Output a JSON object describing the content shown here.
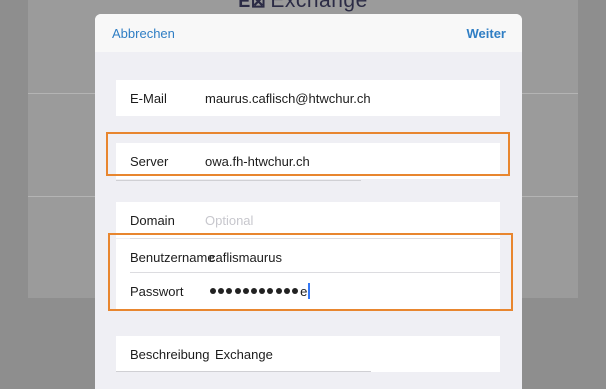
{
  "background": {
    "title": "Exchange",
    "logo_glyph": "E⊠"
  },
  "navbar": {
    "cancel_label": "Abbrechen",
    "next_label": "Weiter"
  },
  "form": {
    "email": {
      "label": "E-Mail",
      "value": "maurus.caflisch@htwchur.ch"
    },
    "server": {
      "label": "Server",
      "value": "owa.fh-htwchur.ch"
    },
    "domain": {
      "label": "Domain",
      "placeholder": "Optional"
    },
    "username": {
      "label": "Benutzername",
      "value": "caflismaurus"
    },
    "password": {
      "label": "Passwort",
      "masked_count": 11,
      "last_char": "e"
    },
    "description": {
      "label": "Beschreibung",
      "value": "Exchange"
    }
  },
  "colors": {
    "accent": "#2f7ec4",
    "highlight": "#e8862f",
    "placeholder": "#c7c7cd"
  }
}
